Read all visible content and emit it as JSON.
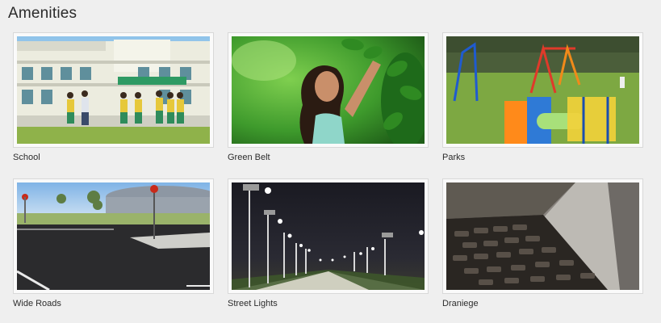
{
  "section": {
    "title": "Amenities"
  },
  "amenities": [
    {
      "label": "School"
    },
    {
      "label": "Green Belt"
    },
    {
      "label": "Parks"
    },
    {
      "label": "Wide Roads"
    },
    {
      "label": "Street Lights"
    },
    {
      "label": "Draniege"
    }
  ]
}
